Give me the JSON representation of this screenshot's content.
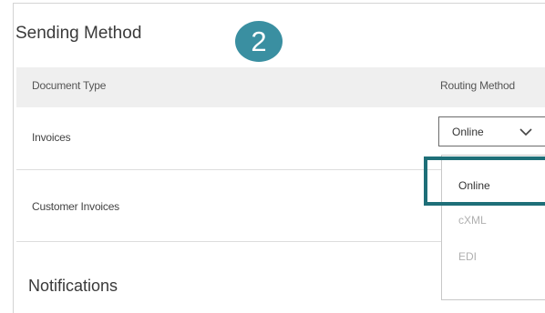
{
  "sending_method": {
    "title": "Sending Method",
    "step_number": "2"
  },
  "table": {
    "headers": {
      "document_type": "Document Type",
      "routing_method": "Routing Method"
    },
    "rows": [
      {
        "document_type": "Invoices",
        "routing_method": "Online"
      },
      {
        "document_type": "Customer Invoices"
      }
    ]
  },
  "dropdown": {
    "options": [
      "Online",
      "cXML",
      "EDI"
    ],
    "highlighted_option": "Online",
    "highlight_color": "#1e6f78",
    "icon": "chevron-down-icon"
  },
  "notifications": {
    "title": "Notifications"
  },
  "colors": {
    "badge": "#3a8fa1",
    "header_bg": "#efefef",
    "disabled_text": "#b0b0b0"
  }
}
